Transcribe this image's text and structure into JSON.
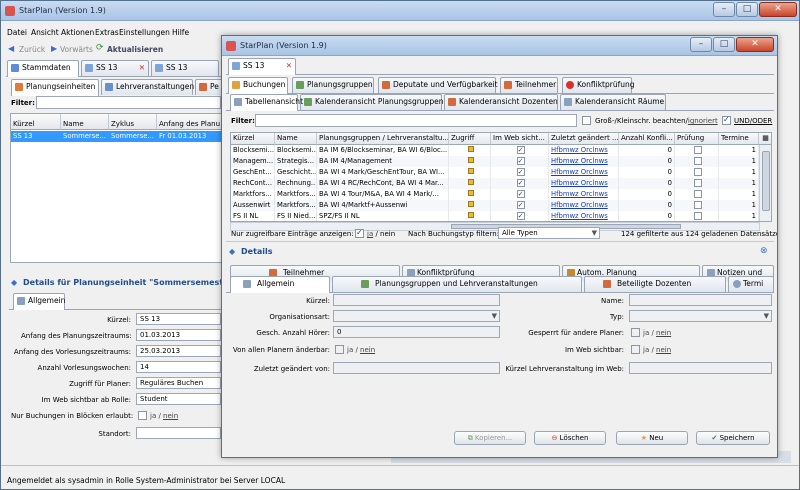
{
  "back_window": {
    "title": "StarPlan (Version 1.9)",
    "controls": {
      "min": "–",
      "max": "□",
      "close": "✕"
    },
    "menu": [
      "Datei",
      "Ansicht",
      "Aktionen",
      "Extras",
      "Einstellungen",
      "Hilfe"
    ],
    "toolbar": {
      "back": "Zurück",
      "forward": "Vorwärts",
      "refresh": "Aktualisieren"
    },
    "top_tabs": [
      "Stammdaten",
      "SS 13",
      "SS 13"
    ],
    "sub_tabs": [
      "Planungseinheiten",
      "Lehrveranstaltungen",
      "Pe"
    ],
    "filter_label": "Filter:",
    "table": {
      "headers": [
        "Kürzel",
        "Name",
        "Zyklus",
        "Anfang des Planu"
      ],
      "rows": [
        [
          "SS 13",
          "Sommerse...",
          "Sommerse...",
          "Fr 01.03.2013"
        ]
      ]
    },
    "details_title": "Details für Planungseinheit \"Sommersemester 2013",
    "details_tab": "Allgemein",
    "fields": [
      {
        "label": "Kürzel:",
        "value": "SS 13"
      },
      {
        "label": "Anfang des Planungszeitraums:",
        "value": "01.03.2013"
      },
      {
        "label": "Anfang des Vorlesungszeitraums:",
        "value": "25.03.2013"
      },
      {
        "label": "Anzahl Vorlesungswochen:",
        "value": "14"
      },
      {
        "label": "Zugriff für Planer:",
        "value": "Reguläres Buchen"
      },
      {
        "label": "Im Web sichtbar ab Rolle:",
        "value": "Student"
      }
    ],
    "block_label": "Nur Buchungen in Blöcken erlaubt:",
    "standort_label": "Standort:",
    "status": "Angemeldet als sysadmin in Rolle System-Administrator bei Server LOCAL"
  },
  "front_window": {
    "title": "StarPlan (Version 1.9)",
    "controls": {
      "min": "–",
      "max": "□",
      "close": "✕"
    },
    "doc_tab": "SS 13",
    "main_tabs": [
      "Buchungen",
      "Planungsgruppen",
      "Deputate und Verfügbarkeit",
      "Teilnehmer",
      "Konfliktprüfung"
    ],
    "view_tabs": [
      "Tabellenansicht",
      "Kalenderansicht Planungsgruppen",
      "Kalenderansicht Dozenten",
      "Kalenderansicht Räume"
    ],
    "filter_label": "Filter:",
    "case_label": "Groß-/Kleinschr. beachten/",
    "case_ignore": "ignoriert",
    "und_oder": "UND/ODER",
    "grid": {
      "headers": [
        "Kürzel",
        "Name",
        "Planungsgruppen / Lehrveranstaltu...",
        "Zugriff",
        "Im Web sicht...",
        "Zuletzt geändert ...",
        "Anzahl Konfli...",
        "Prüfung",
        "Termine"
      ],
      "rows": [
        [
          "Blocksemi...",
          "Blocksemi...",
          "BA IM 6/Blockseminar, BA WI 6/Bloc...",
          "Hfbmwz Orclnws",
          "0",
          "1"
        ],
        [
          "Managem...",
          "Strategis...",
          "BA IM 4/Management",
          "Hfbmwz Orclnws",
          "0",
          "1"
        ],
        [
          "GeschEnt...",
          "Geschicht...",
          "BA WI 4 Mark/GeschEntTour, BA WI...",
          "Hfbmwz Orclnws",
          "0",
          "1"
        ],
        [
          "RechCont...",
          "Rechnung...",
          "BA WI 4 RC/RechCont, BA WI 4 Mar...",
          "Hfbmwz Orclnws",
          "0",
          "1"
        ],
        [
          "Marktfors...",
          "Marktfors...",
          "BA WI 4 Tour/M&A, BA WI 4 Mark/...",
          "Hfbmwz Orclnws",
          "0",
          "1"
        ],
        [
          "Aussenwirt",
          "Marktfors...",
          "BA WI 4/Marktf+Aussenwi",
          "Hfbmwz Orclnws",
          "0",
          "1"
        ],
        [
          "FS II NL",
          "FS II Nied...",
          "SPZ/FS II NL",
          "Hfbmwz Orclnws",
          "0",
          "1"
        ]
      ]
    },
    "accessible_label": "Nur zugreifbare Einträge anzeigen:",
    "ja": "ja",
    "nein": "nein",
    "type_filter_label": "Nach Buchungstyp filtern:",
    "type_filter_value": "Alle Typen",
    "count_text": "124 gefilterte aus 124 geladenen Datensätzen",
    "details_title": "Details",
    "detail_tabs_row1": [
      "Teilnehmer",
      "Konfliktprüfung",
      "Autom. Planung",
      "Notizen und"
    ],
    "detail_tabs_row2": [
      "Allgemein",
      "Planungsgruppen und Lehrveranstaltungen",
      "Beteiligte Dozenten",
      "Termi"
    ],
    "left_fields": {
      "kuerzel": "Kürzel:",
      "org": "Organisationsart:",
      "hoerer": "Gesch. Anzahl Hörer:",
      "hoerer_val": "0",
      "aenderbar": "Von allen Planern änderbar:",
      "zuletzt": "Zuletzt geändert von:"
    },
    "right_fields": {
      "name": "Name:",
      "typ": "Typ:",
      "gesperrt": "Gesperrt für andere Planer:",
      "web": "Im Web sichtbar:",
      "lv": "Kürzel Lehrveranstaltung im Web:"
    },
    "buttons": {
      "copy": "Kopieren...",
      "delete": "Löschen",
      "new": "Neu",
      "save": "Speichern"
    }
  },
  "colors": {
    "titlebar": "#b9cfea",
    "row_selected": "#3399ff",
    "link": "#1a3fb0"
  }
}
